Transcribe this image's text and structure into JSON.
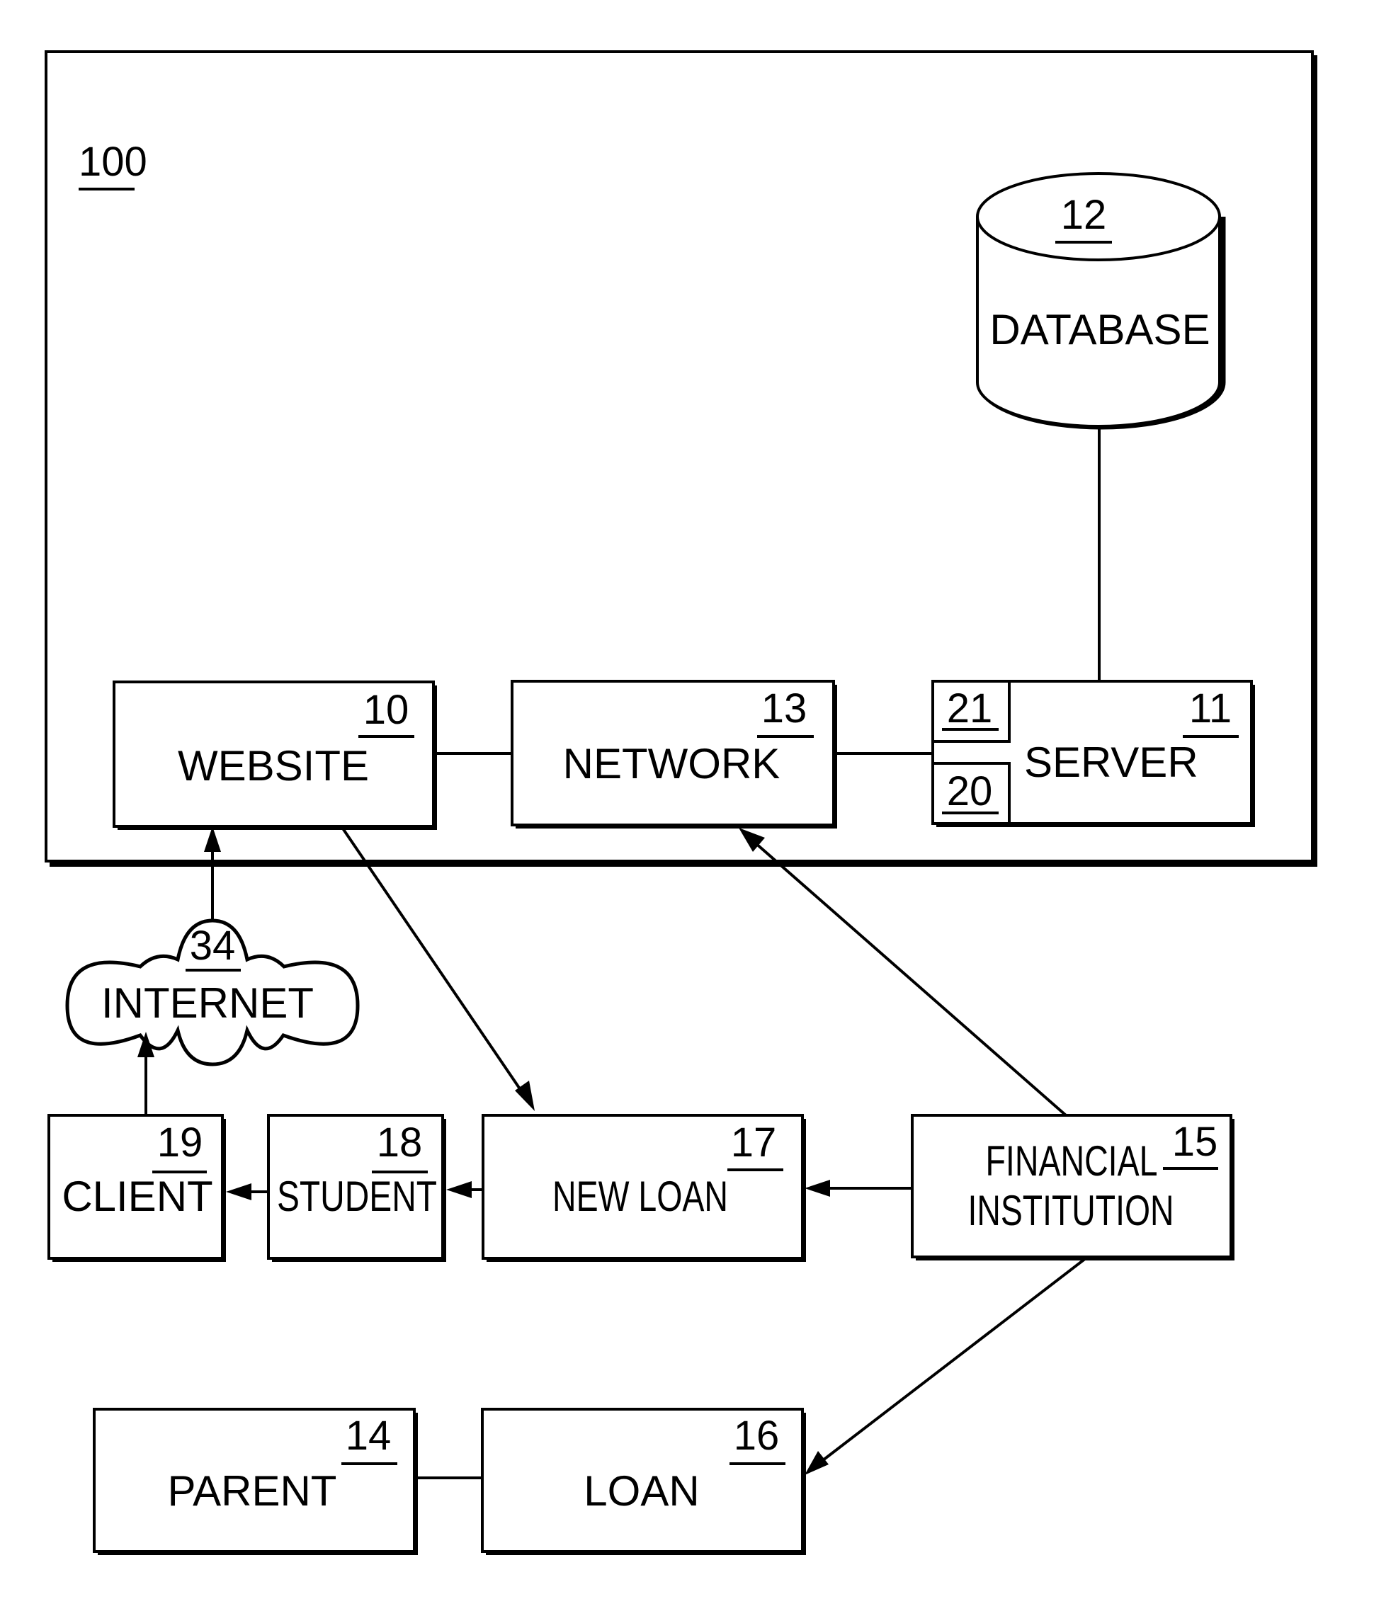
{
  "figure": {
    "system": {
      "ref": "100"
    },
    "nodes": {
      "database": {
        "label": "DATABASE",
        "ref": "12"
      },
      "website": {
        "label": "WEBSITE",
        "ref": "10"
      },
      "network": {
        "label": "NETWORK",
        "ref": "13"
      },
      "server": {
        "label": "SERVER",
        "ref": "11",
        "sub_refs": [
          "21",
          "20"
        ]
      },
      "internet": {
        "label": "INTERNET",
        "ref": "34"
      },
      "client": {
        "label": "CLIENT",
        "ref": "19"
      },
      "student": {
        "label": "STUDENT",
        "ref": "18"
      },
      "new_loan": {
        "label": "NEW LOAN",
        "ref": "17"
      },
      "financial_institution": {
        "label_line1": "FINANCIAL",
        "label_line2": "INSTITUTION",
        "ref": "15"
      },
      "parent": {
        "label": "PARENT",
        "ref": "14"
      },
      "loan": {
        "label": "LOAN",
        "ref": "16"
      }
    },
    "edges": [
      {
        "from": "database",
        "to": "server",
        "arrow": false
      },
      {
        "from": "website",
        "to": "network",
        "arrow": false
      },
      {
        "from": "network",
        "to": "server",
        "arrow": false
      },
      {
        "from": "internet",
        "to": "website",
        "arrow": true
      },
      {
        "from": "client",
        "to": "internet",
        "arrow": true
      },
      {
        "from": "website",
        "to": "new_loan",
        "arrow": true
      },
      {
        "from": "financial_institution",
        "to": "network",
        "arrow": true
      },
      {
        "from": "financial_institution",
        "to": "new_loan",
        "arrow": true
      },
      {
        "from": "new_loan",
        "to": "student",
        "arrow": true
      },
      {
        "from": "student",
        "to": "client",
        "arrow": true
      },
      {
        "from": "financial_institution",
        "to": "loan",
        "arrow": true
      },
      {
        "from": "parent",
        "to": "loan",
        "arrow": false
      }
    ]
  }
}
